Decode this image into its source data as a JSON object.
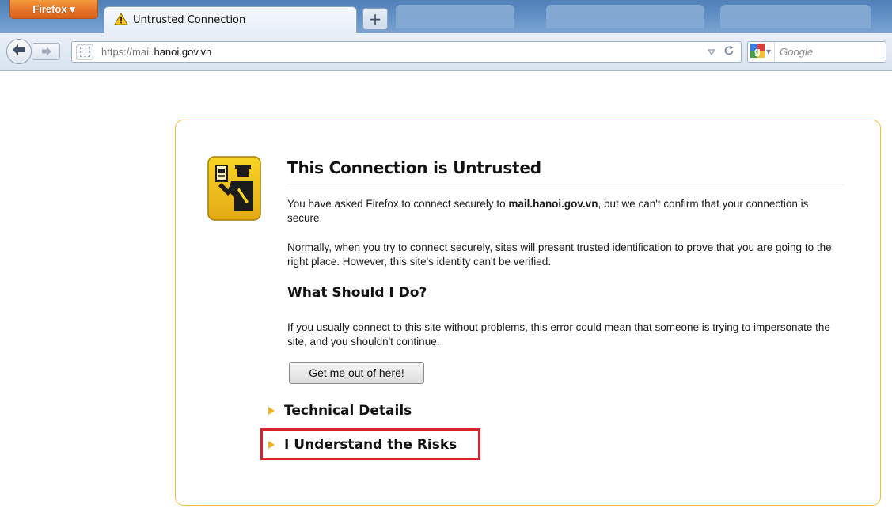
{
  "app": {
    "menu_button_label": "Firefox ▾"
  },
  "tabs": [
    {
      "title": "Untrusted Connection"
    }
  ],
  "toolbar": {
    "new_tab_label": "+",
    "url_prefix": "https://mail.",
    "url_domain": "hanoi.gov.vn",
    "search_placeholder": "Google"
  },
  "error_page": {
    "title": "This Connection is Untrusted",
    "intro_before": "You have asked Firefox to connect securely to ",
    "intro_host": "mail.hanoi.gov.vn",
    "intro_after": ", but we can't confirm that your connection is secure.",
    "normally": "Normally, when you try to connect securely, sites will present trusted identification to prove that you are going to the right place. However, this site's identity can't be verified.",
    "what_heading": "What Should I Do?",
    "what_text": "If you usually connect to this site without problems, this error could mean that someone is trying to impersonate the site, and you shouldn't continue.",
    "get_out_button": "Get me out of here!",
    "technical_details": "Technical Details",
    "understand_risks": "I Understand the Risks"
  },
  "colors": {
    "panel_border": "#f2bd3a",
    "highlight_box": "#d9222a",
    "firefox_button": "#e7742a"
  }
}
